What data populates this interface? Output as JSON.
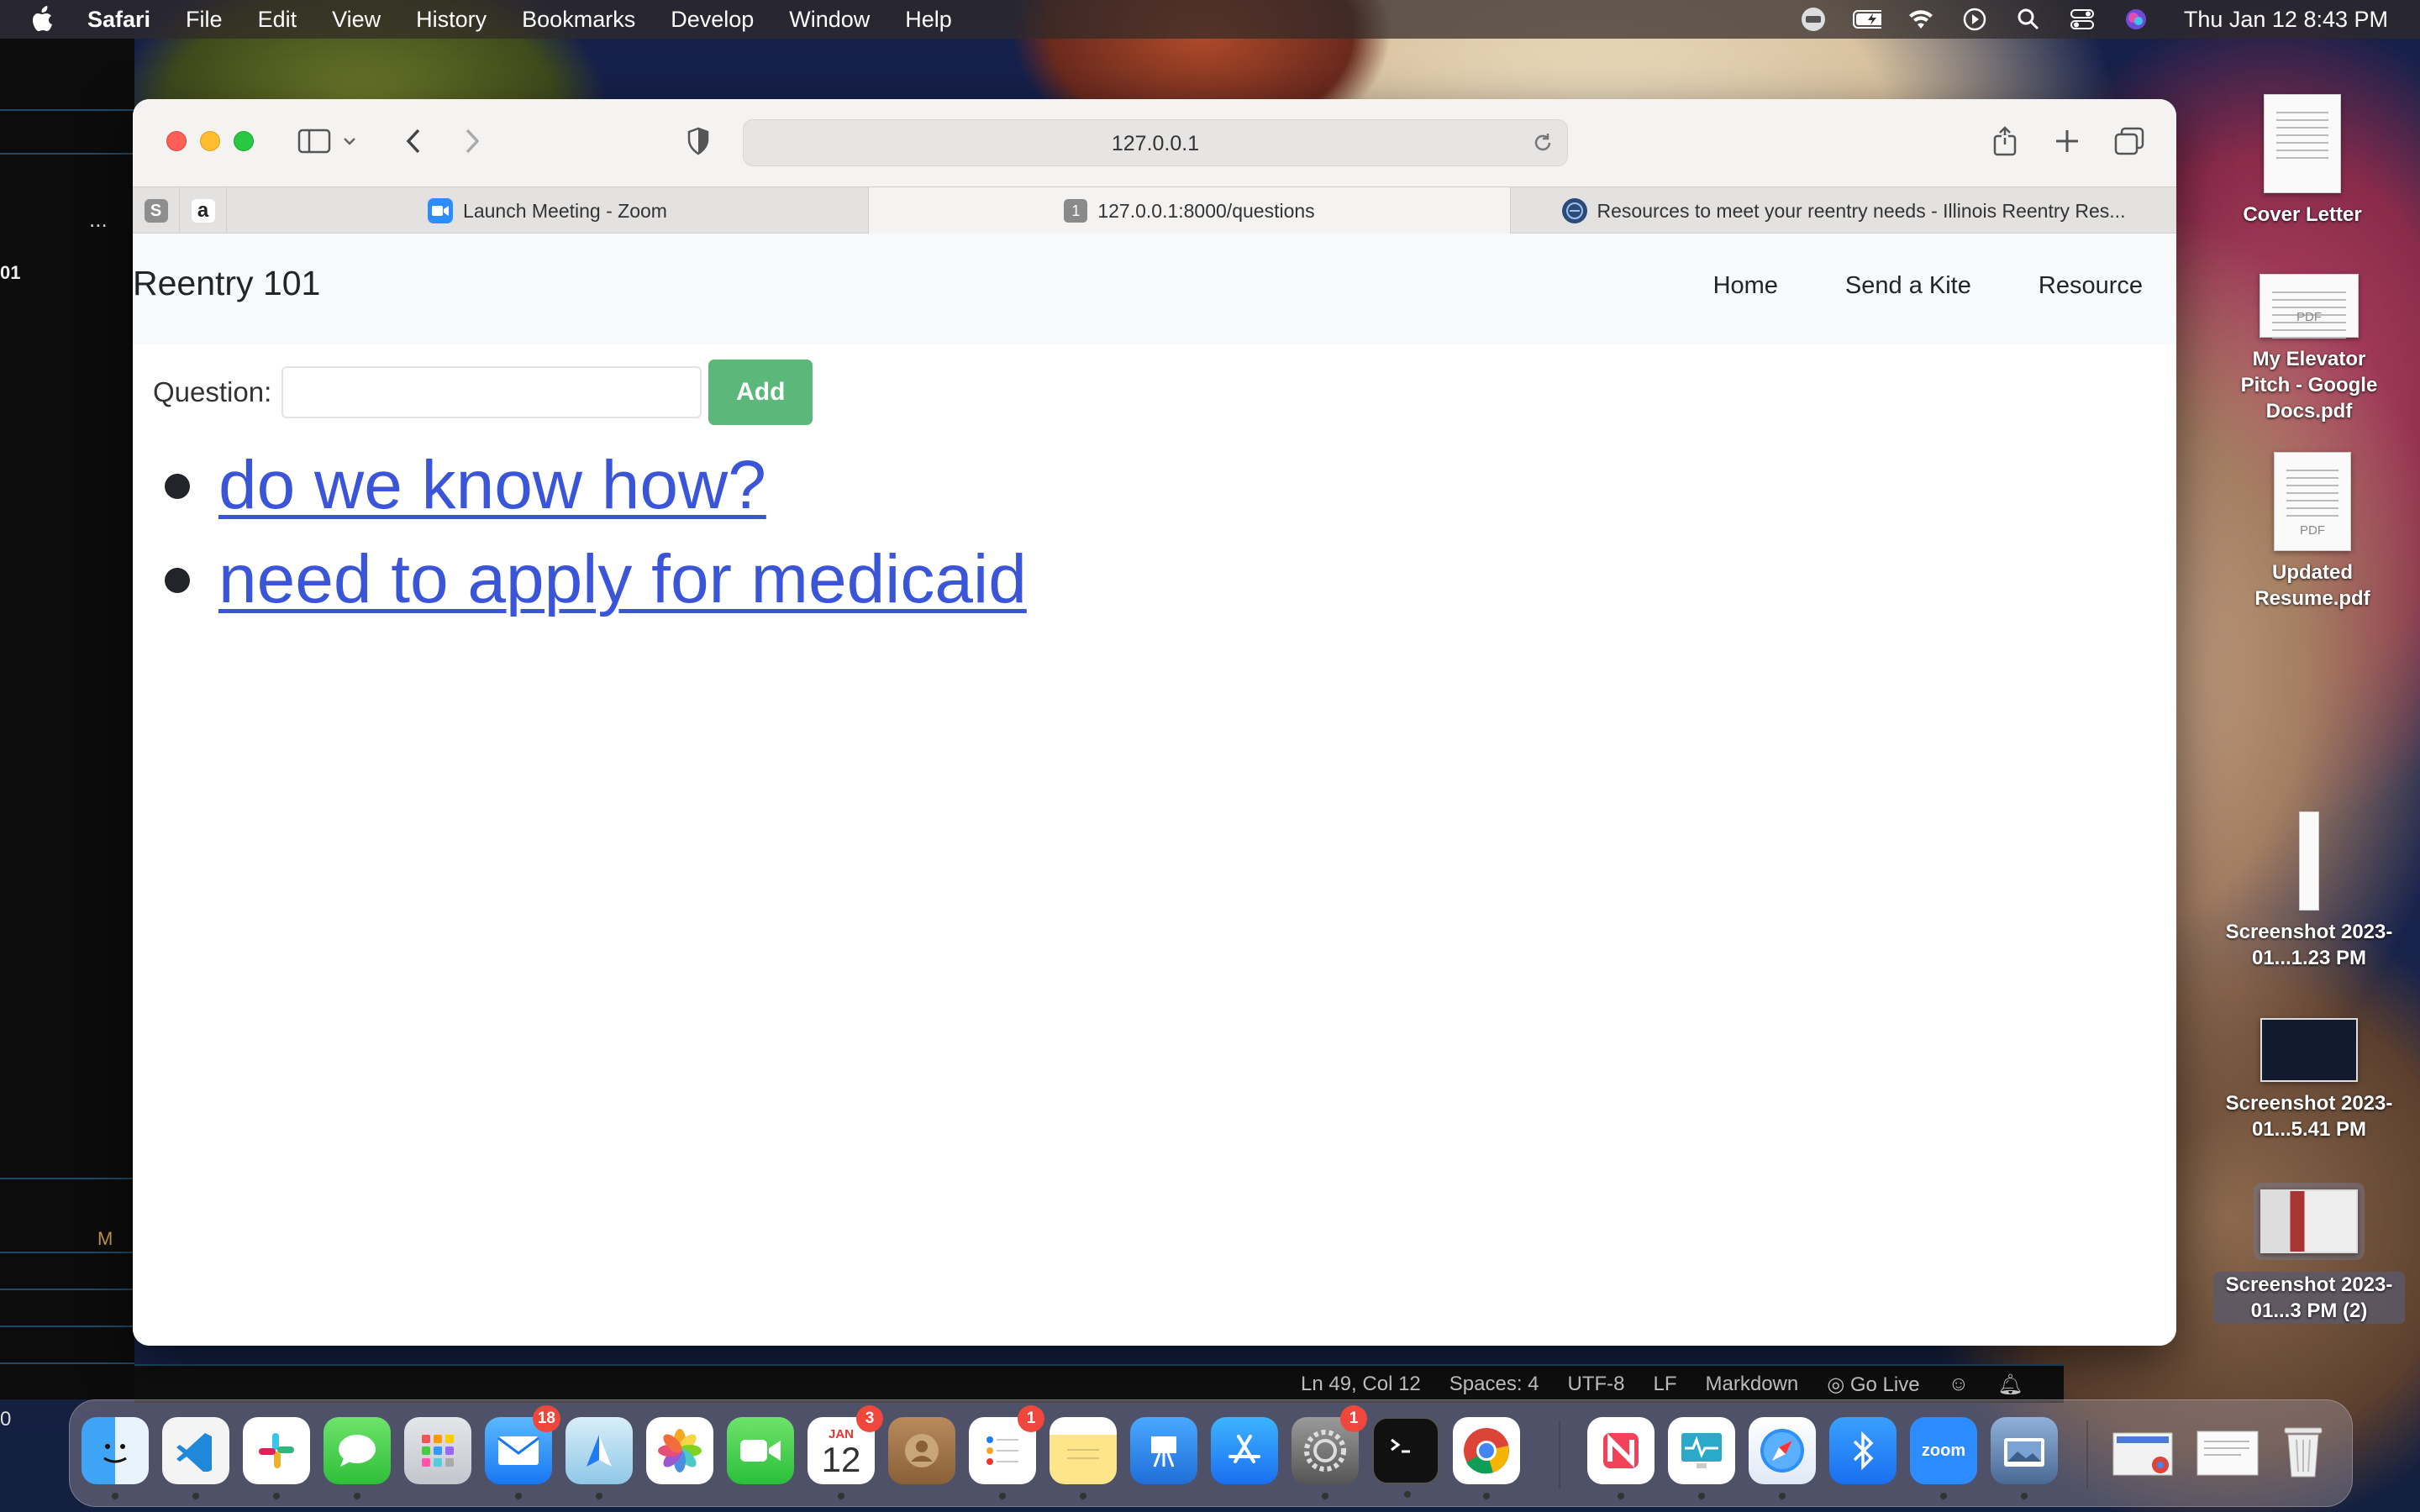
{
  "menubar": {
    "app_name": "Safari",
    "items": [
      "File",
      "Edit",
      "View",
      "History",
      "Bookmarks",
      "Develop",
      "Window",
      "Help"
    ],
    "clock": "Thu Jan 12  8:43 PM"
  },
  "safari": {
    "url": "127.0.0.1",
    "tabs": [
      {
        "label": "Launch Meeting - Zoom",
        "icon": "zoom-icon"
      },
      {
        "label": "127.0.0.1:8000/questions",
        "icon": "numbered-tab-icon",
        "active": true
      },
      {
        "label": "Resources to meet your reentry needs - Illinois Reentry Res...",
        "icon": "reentry-site-icon"
      }
    ],
    "pinned_tabs": {
      "first": "S",
      "second": "a"
    }
  },
  "page": {
    "brand": "Reentry 101",
    "nav": {
      "home": "Home",
      "send_kite": "Send a Kite",
      "resource": "Resource"
    },
    "form": {
      "label": "Question:",
      "value": "",
      "placeholder": "",
      "button": "Add"
    },
    "questions": [
      "do we know how?",
      "need to apply for medicaid"
    ]
  },
  "desktop_icons": {
    "cover_letter": "Cover Letter",
    "elevator_pitch": "My Elevator Pitch - Google Docs.pdf",
    "resume": "Updated Resume.pdf",
    "screenshot1": "Screenshot 2023-01...1.23 PM",
    "screenshot2": "Screenshot 2023-01...5.41 PM",
    "screenshot3": "Screenshot 2023-01...3 PM (2)",
    "pdf_tag": "PDF"
  },
  "background_editor": {
    "dots": "...",
    "line_num": "01",
    "marker": "M",
    "zero": "0",
    "status": {
      "position": "Ln 49, Col 12",
      "spaces": "Spaces: 4",
      "encoding": "UTF-8",
      "eol": "LF",
      "language": "Markdown",
      "go_live": "Go Live"
    }
  },
  "dock": {
    "badges": {
      "mail": "18",
      "calendar": "3",
      "reminders": "1",
      "settings": "1"
    },
    "calendar": {
      "month": "JAN",
      "day": "12"
    },
    "zoom_label": "zoom"
  },
  "colors": {
    "link": "#3a55d8",
    "add_button": "#5cb77a",
    "navbar_bg": "#f8f9fa"
  }
}
